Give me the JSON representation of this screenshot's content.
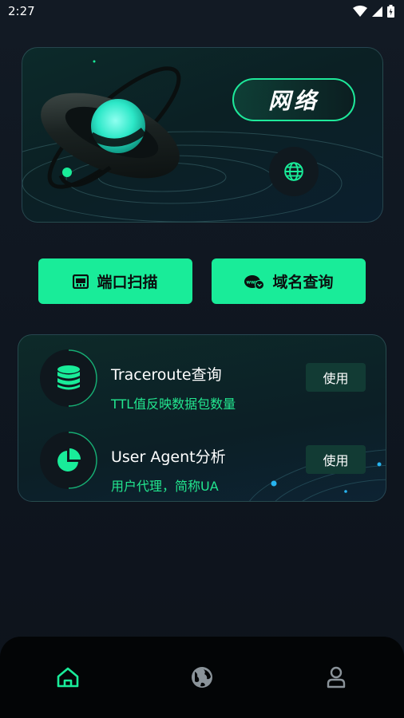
{
  "status_bar": {
    "time": "2:27"
  },
  "hero": {
    "badge_text": "网络"
  },
  "actions": [
    {
      "label": "端口扫描",
      "icon": "port-scan-icon"
    },
    {
      "label": "域名查询",
      "icon": "www-domain-icon"
    }
  ],
  "tools": [
    {
      "title": "Traceroute查询",
      "description": "TTL值反映数据包数量",
      "button": "使用",
      "icon": "database-icon"
    },
    {
      "title": "User Agent分析",
      "description": "用户代理，简称UA",
      "button": "使用",
      "icon": "pie-chart-icon"
    }
  ],
  "bottom_nav": [
    {
      "name": "home",
      "icon": "home-icon",
      "active": true
    },
    {
      "name": "web",
      "icon": "globe-icon",
      "active": false
    },
    {
      "name": "profile",
      "icon": "user-icon",
      "active": false
    }
  ],
  "colors": {
    "accent": "#19ec99",
    "accent_text": "#22e68f",
    "background": "#121a24"
  }
}
